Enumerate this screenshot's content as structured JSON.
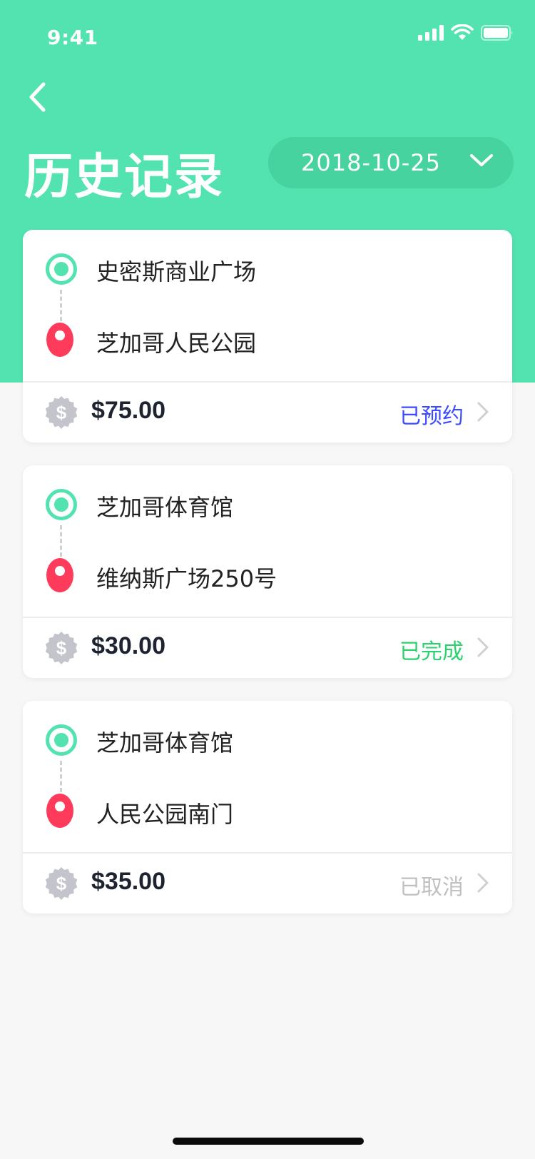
{
  "status_bar": {
    "time": "9:41"
  },
  "header": {
    "title": "历史记录",
    "date": "2018-10-25"
  },
  "colors": {
    "accent": "#52e3b0",
    "pin": "#ff3b5c",
    "booked": "#3b4bff",
    "completed": "#2ad16e",
    "cancelled": "#c0c0c0"
  },
  "orders": [
    {
      "origin": "史密斯商业广场",
      "destination": "芝加哥人民公园",
      "price": "$75.00",
      "status": "已预约",
      "status_color": "#3b4bff"
    },
    {
      "origin": "芝加哥体育馆",
      "destination": "维纳斯广场250号",
      "price": "$30.00",
      "status": "已完成",
      "status_color": "#2ad16e"
    },
    {
      "origin": "芝加哥体育馆",
      "destination": "人民公园南门",
      "price": "$35.00",
      "status": "已取消",
      "status_color": "#c0c0c0"
    }
  ]
}
